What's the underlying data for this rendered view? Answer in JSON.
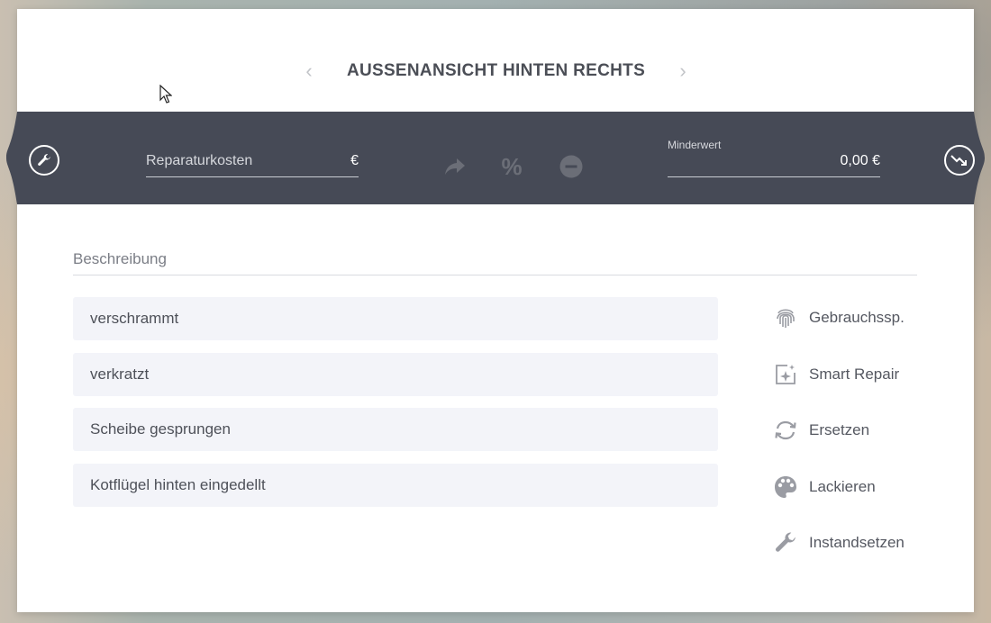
{
  "header": {
    "title": "AUSSENANSICHT HINTEN RECHTS",
    "prev_icon": "chevron-left-icon",
    "next_icon": "chevron-right-icon"
  },
  "cost_bar": {
    "repair_cost_label": "Reparaturkosten",
    "repair_cost_unit": "€",
    "percent_symbol": "%",
    "minderwert_label": "Minderwert",
    "minderwert_value": "0,00 €",
    "left_icon": "wrench-icon",
    "right_icon": "trend-down-icon"
  },
  "description": {
    "label": "Beschreibung",
    "items": [
      {
        "label": "verschrammt"
      },
      {
        "label": "verkratzt"
      },
      {
        "label": "Scheibe gesprungen"
      },
      {
        "label": "Kotflügel hinten eingedellt"
      }
    ]
  },
  "actions": [
    {
      "label": "Gebrauchssp.",
      "icon": "fingerprint-icon"
    },
    {
      "label": "Smart Repair",
      "icon": "smart-repair-icon"
    },
    {
      "label": "Ersetzen",
      "icon": "replace-icon"
    },
    {
      "label": "Lackieren",
      "icon": "palette-icon"
    },
    {
      "label": "Instandsetzen",
      "icon": "wrench-icon"
    }
  ],
  "colors": {
    "bar": "#464a56",
    "accent_text": "#4b4e56"
  }
}
